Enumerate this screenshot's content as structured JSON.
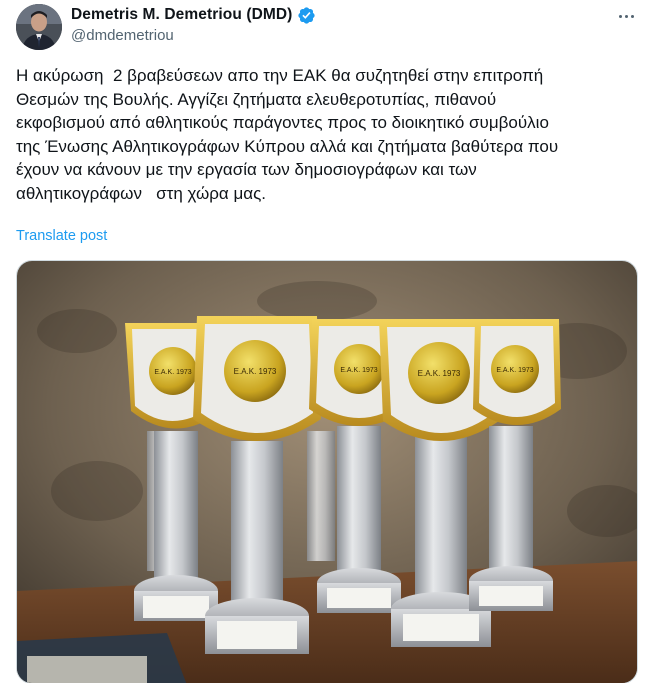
{
  "post": {
    "author": {
      "display_name": "Demetris M. Demetriou (DMD)",
      "handle": "@dmdemetriou",
      "verified": true,
      "avatar_icon": "user-avatar"
    },
    "more_icon": "more-horizontal-icon",
    "text_lines": [
      "Η ακύρωση  2 βραβεύσεων απο την ΕΑΚ θα συζητηθεί στην επιτροπή",
      "Θεσμών της Βουλής. Αγγίζει ζητήματα ελευθεροτυπίας, πιθανού",
      "εκφοβισμού από αθλητικούς παράγοντες προς το διοικητικό συμβούλιο",
      "της Ένωσης Αθλητικογράφων Κύπρου αλλά και ζητήματα βαθύτερα που",
      "έχουν να κάνουν με την εργασία των δημοσιογράφων και των",
      "αθλητικογράφων   στη χώρα μας."
    ],
    "translate_label": "Translate post",
    "media": {
      "description_icon": "photo-trophies",
      "medal_text": "Ε.Α.Κ. 1973"
    }
  },
  "colors": {
    "text": "#0f1419",
    "secondary": "#536471",
    "link": "#1d9bf0",
    "verified": "#1d9bf0",
    "border": "#cfd9de"
  }
}
